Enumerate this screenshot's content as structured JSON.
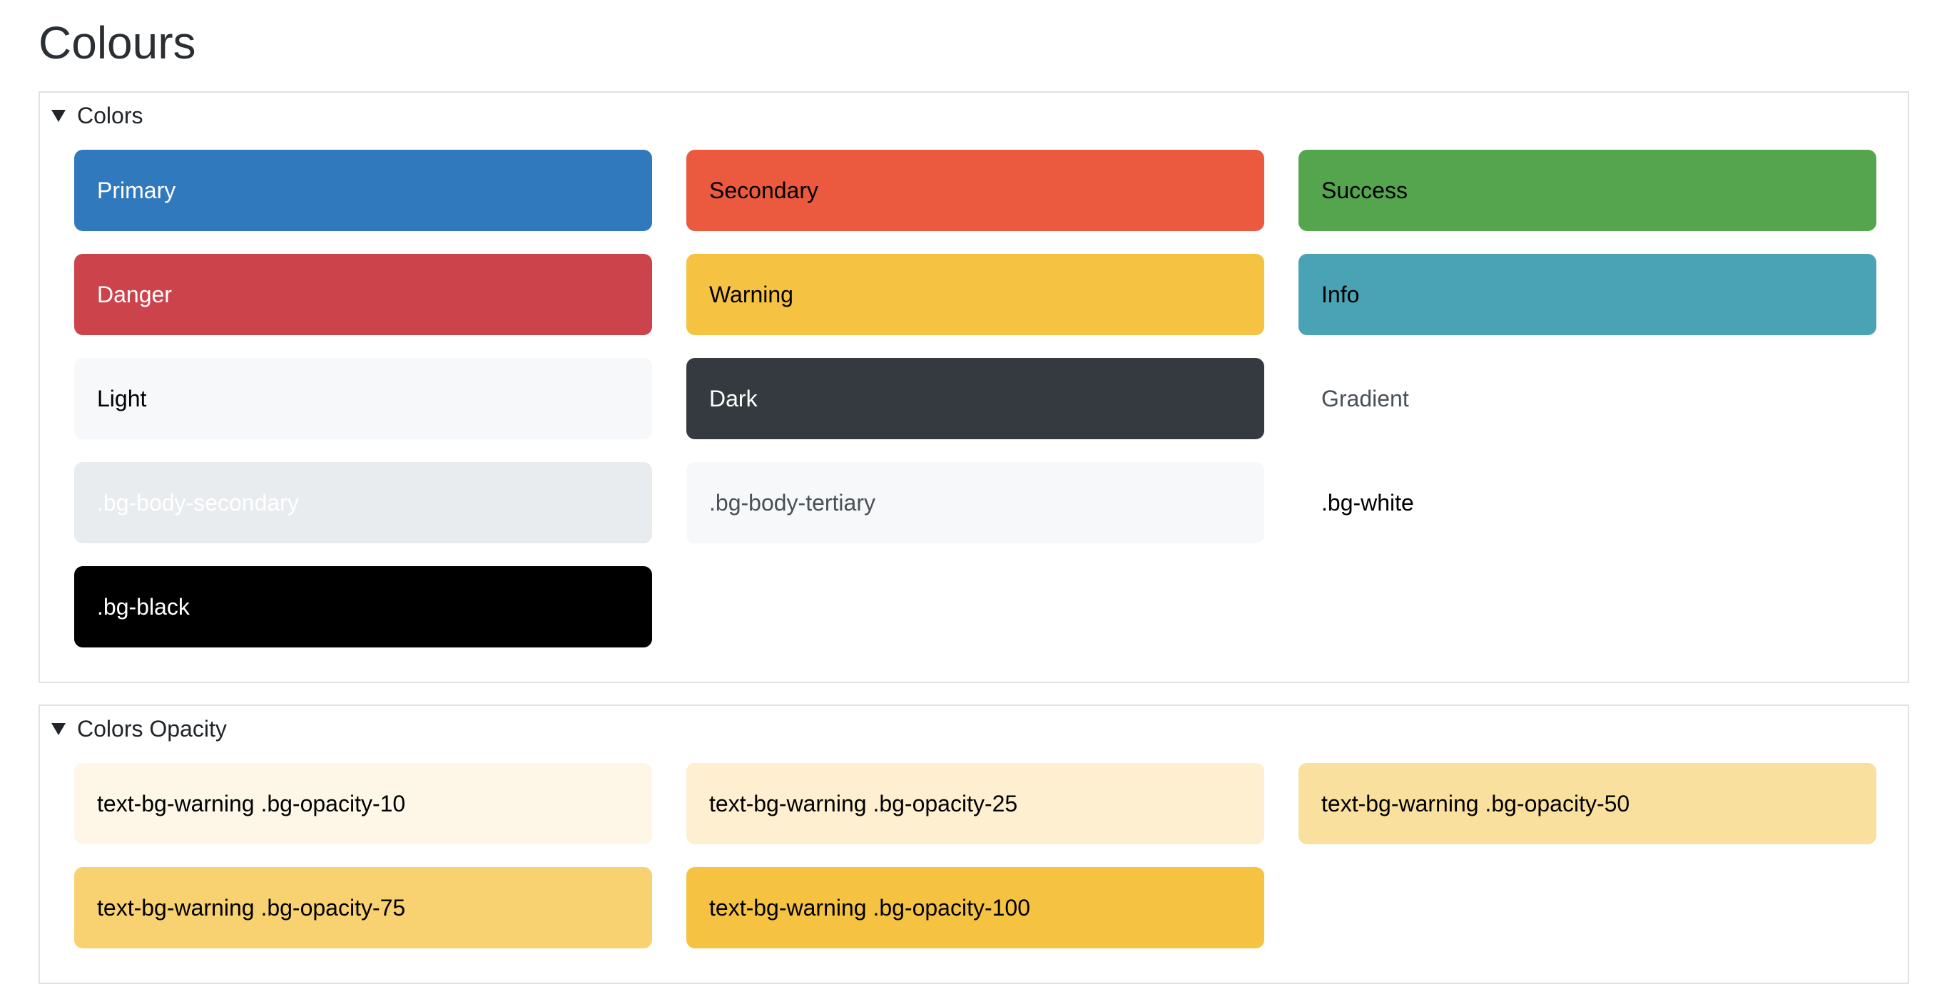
{
  "page": {
    "title": "Colours"
  },
  "colors": {
    "summary": "Colors",
    "items": [
      {
        "label": "Primary",
        "color": "#3079bd"
      },
      {
        "label": "Secondary",
        "color": "#eb5a3e"
      },
      {
        "label": "Success",
        "color": "#54a54e"
      },
      {
        "label": "Danger",
        "color": "#cc434b"
      },
      {
        "label": "Warning",
        "color": "#f5c242"
      },
      {
        "label": "Info",
        "color": "#4aa2b5"
      },
      {
        "label": "Light",
        "color": "#f7f8fa"
      },
      {
        "label": "Dark",
        "color": "#343a40"
      },
      {
        "label": "Gradient",
        "color": "#ffffff"
      },
      {
        "label": ".bg-body-secondary",
        "color": "#e9ecef"
      },
      {
        "label": ".bg-body-tertiary",
        "color": "#f7f8fa"
      },
      {
        "label": ".bg-white",
        "color": "#ffffff"
      },
      {
        "label": ".bg-black",
        "color": "#000000"
      }
    ]
  },
  "opacity": {
    "summary": "Colors Opacity",
    "items": [
      {
        "label": "text-bg-warning .bg-opacity-10",
        "color": "#fef7e8"
      },
      {
        "label": "text-bg-warning .bg-opacity-25",
        "color": "#fdefcf"
      },
      {
        "label": "text-bg-warning .bg-opacity-50",
        "color": "#fae09f"
      },
      {
        "label": "text-bg-warning .bg-opacity-75",
        "color": "#f8d170"
      },
      {
        "label": "text-bg-warning .bg-opacity-100",
        "color": "#f5c242"
      }
    ]
  }
}
